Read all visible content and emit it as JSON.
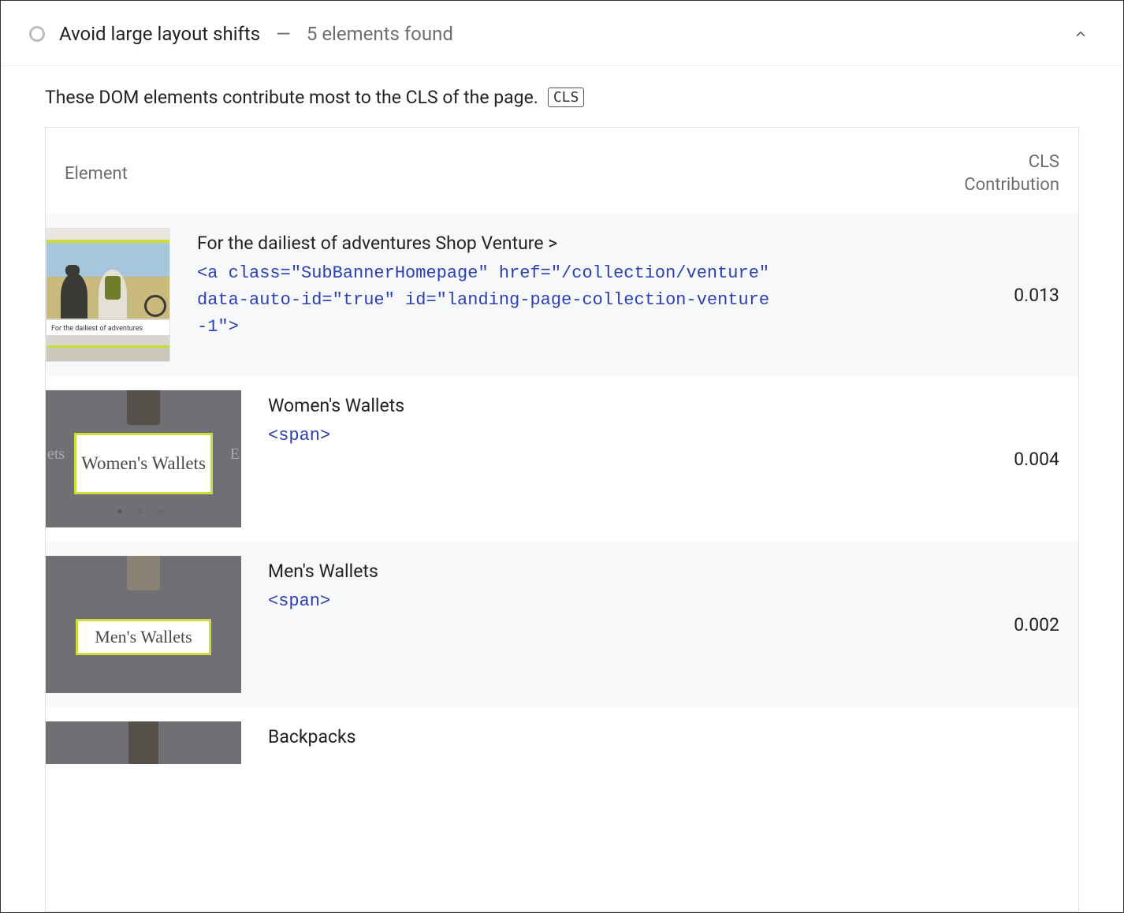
{
  "audit": {
    "title": "Avoid large layout shifts",
    "subtitle": "5 elements found",
    "description": "These DOM elements contribute most to the CLS of the page.",
    "chip": "CLS"
  },
  "columns": {
    "element": "Element",
    "cls": "CLS Contribution"
  },
  "rows": [
    {
      "name": "For the dailiest of adventures Shop Venture >",
      "snippet": "<a class=\"SubBannerHomepage\" href=\"/collection/venture\" data-auto-id=\"true\" id=\"landing-page-collection-venture-1\">",
      "cls": "0.013",
      "thumb": {
        "caption": "For the dailiest of adventures",
        "shop": "Shop Venture >"
      }
    },
    {
      "name": "Women's Wallets",
      "snippet": "<span>",
      "cls": "0.004",
      "thumb": {
        "label": "Women's Wallets",
        "left": "ets",
        "right": "E",
        "dots": true
      }
    },
    {
      "name": "Men's Wallets",
      "snippet": "<span>",
      "cls": "0.002",
      "thumb": {
        "label": "Men's Wallets"
      }
    },
    {
      "name": "Backpacks",
      "snippet": "",
      "cls": "",
      "thumb": {
        "partial": true
      }
    }
  ]
}
